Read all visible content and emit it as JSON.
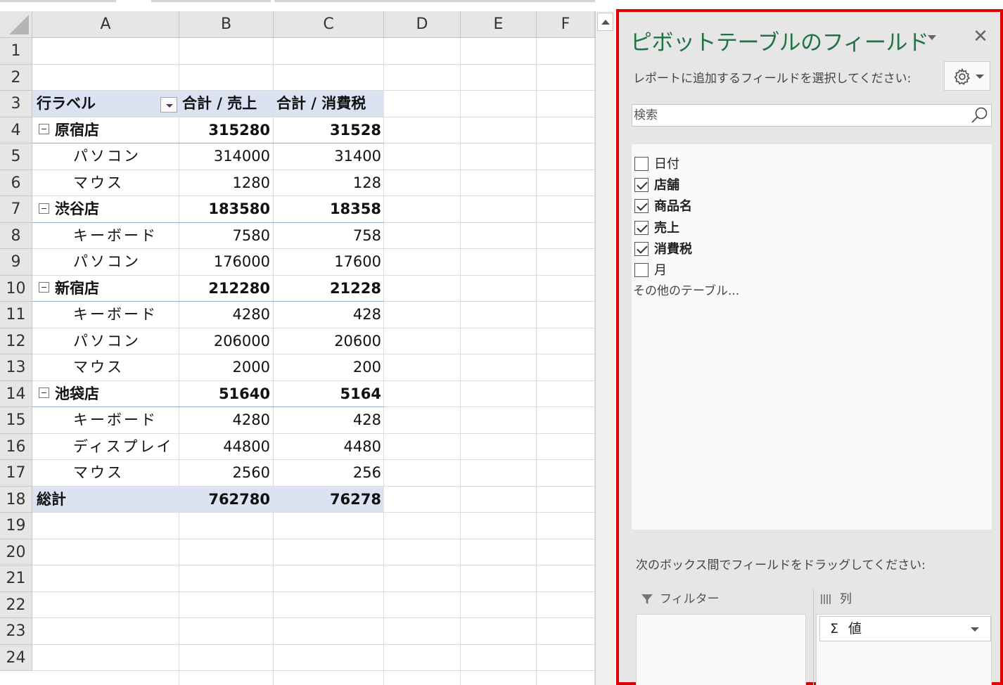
{
  "sheet": {
    "columns": [
      "A",
      "B",
      "C",
      "D",
      "E",
      "F"
    ],
    "rows": [
      "1",
      "2",
      "3",
      "4",
      "5",
      "6",
      "7",
      "8",
      "9",
      "10",
      "11",
      "12",
      "13",
      "14",
      "15",
      "16",
      "17",
      "18",
      "19",
      "20",
      "21",
      "22",
      "23",
      "24"
    ],
    "pivot": {
      "header": {
        "row_label": "行ラベル",
        "col_b": "合計 / 売上",
        "col_c": "合計 / 消費税"
      },
      "lines": [
        {
          "label": "原宿店",
          "sales": "315280",
          "tax": "31528",
          "type": "group"
        },
        {
          "label": "パソコン",
          "sales": "314000",
          "tax": "31400",
          "type": "item"
        },
        {
          "label": "マウス",
          "sales": "1280",
          "tax": "128",
          "type": "item"
        },
        {
          "label": "渋谷店",
          "sales": "183580",
          "tax": "18358",
          "type": "group"
        },
        {
          "label": "キーボード",
          "sales": "7580",
          "tax": "758",
          "type": "item"
        },
        {
          "label": "パソコン",
          "sales": "176000",
          "tax": "17600",
          "type": "item"
        },
        {
          "label": "新宿店",
          "sales": "212280",
          "tax": "21228",
          "type": "group"
        },
        {
          "label": "キーボード",
          "sales": "4280",
          "tax": "428",
          "type": "item"
        },
        {
          "label": "パソコン",
          "sales": "206000",
          "tax": "20600",
          "type": "item"
        },
        {
          "label": "マウス",
          "sales": "2000",
          "tax": "200",
          "type": "item"
        },
        {
          "label": "池袋店",
          "sales": "51640",
          "tax": "5164",
          "type": "group"
        },
        {
          "label": "キーボード",
          "sales": "4280",
          "tax": "428",
          "type": "item"
        },
        {
          "label": "ディスプレイ",
          "sales": "44800",
          "tax": "4480",
          "type": "item"
        },
        {
          "label": "マウス",
          "sales": "2560",
          "tax": "256",
          "type": "item"
        },
        {
          "label": "総計",
          "sales": "762780",
          "tax": "76278",
          "type": "total"
        }
      ]
    }
  },
  "pane": {
    "title": "ピボットテーブルのフィールド",
    "close_glyph": "✕",
    "instruction": "レポートに追加するフィールドを選択してください:",
    "search_placeholder": "検索",
    "fields": [
      {
        "label": "日付",
        "checked": false
      },
      {
        "label": "店舗",
        "checked": true
      },
      {
        "label": "商品名",
        "checked": true
      },
      {
        "label": "売上",
        "checked": true
      },
      {
        "label": "消費税",
        "checked": true
      },
      {
        "label": "月",
        "checked": false
      }
    ],
    "more_tables": "その他のテーブル...",
    "drag_instruction": "次のボックス間でフィールドをドラッグしてください:",
    "filter_label": "フィルター",
    "columns_label": "列",
    "values_item": {
      "sigma": "Σ",
      "label": "値"
    },
    "accent_color": "#217346",
    "highlight_border_color": "#e00000"
  }
}
